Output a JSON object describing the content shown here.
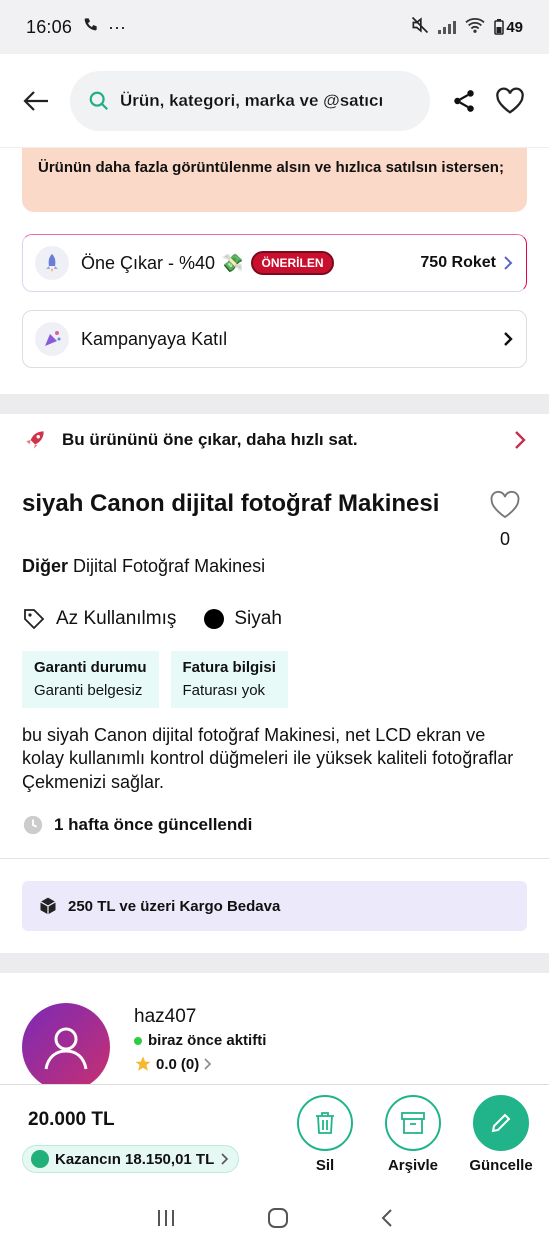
{
  "status_bar": {
    "time": "16:06",
    "dots": "···",
    "battery": "49"
  },
  "header": {
    "search_placeholder": "Ürün, kategori, marka ve @satıcı"
  },
  "promo": {
    "banner_text": "Ürünün daha fazla görüntülenme alsın ve hızlıca satılsın istersen;",
    "boost_label": "Öne Çıkar - %40",
    "boost_emoji": "💸",
    "boost_badge": "ÖNERİLEN",
    "boost_price": "750 Roket",
    "campaign_label": "Kampanyaya Katıl"
  },
  "product": {
    "boost_text": "Bu ürününü öne çıkar, daha hızlı sat.",
    "title": "siyah Canon dijital fotoğraf Makinesi",
    "favorite_count": "0",
    "category_main": "Diğer",
    "category_sub": "Dijital Fotoğraf Makinesi",
    "condition": "Az Kullanılmış",
    "color": "Siyah",
    "warranty_label": "Garanti durumu",
    "warranty_value": "Garanti belgesiz",
    "invoice_label": "Fatura bilgisi",
    "invoice_value": "Faturası yok",
    "description": "bu siyah Canon dijital fotoğraf Makinesi, net LCD ekran ve kolay kullanımlı kontrol düğmeleri ile yüksek kaliteli fotoğraflar Çekmenizi sağlar.",
    "updated": "1 hafta önce güncellendi",
    "cargo_text": "250 TL ve üzeri Kargo Bedava"
  },
  "seller": {
    "username": "haz407",
    "activity": "biraz önce aktifti",
    "rating": "0.0",
    "rating_count": "(0)"
  },
  "bottom_bar": {
    "price": "20.000 TL",
    "earnings": "Kazancın 18.150,01 TL",
    "delete_label": "Sil",
    "archive_label": "Arşivle",
    "update_label": "Güncelle"
  },
  "colors": {
    "accent_green": "#21b48a",
    "promo_bg": "#fbd9c8",
    "badge_red": "#c8102e",
    "cargo_bg": "#ece9fb",
    "info_box_bg": "#e8faf7"
  }
}
